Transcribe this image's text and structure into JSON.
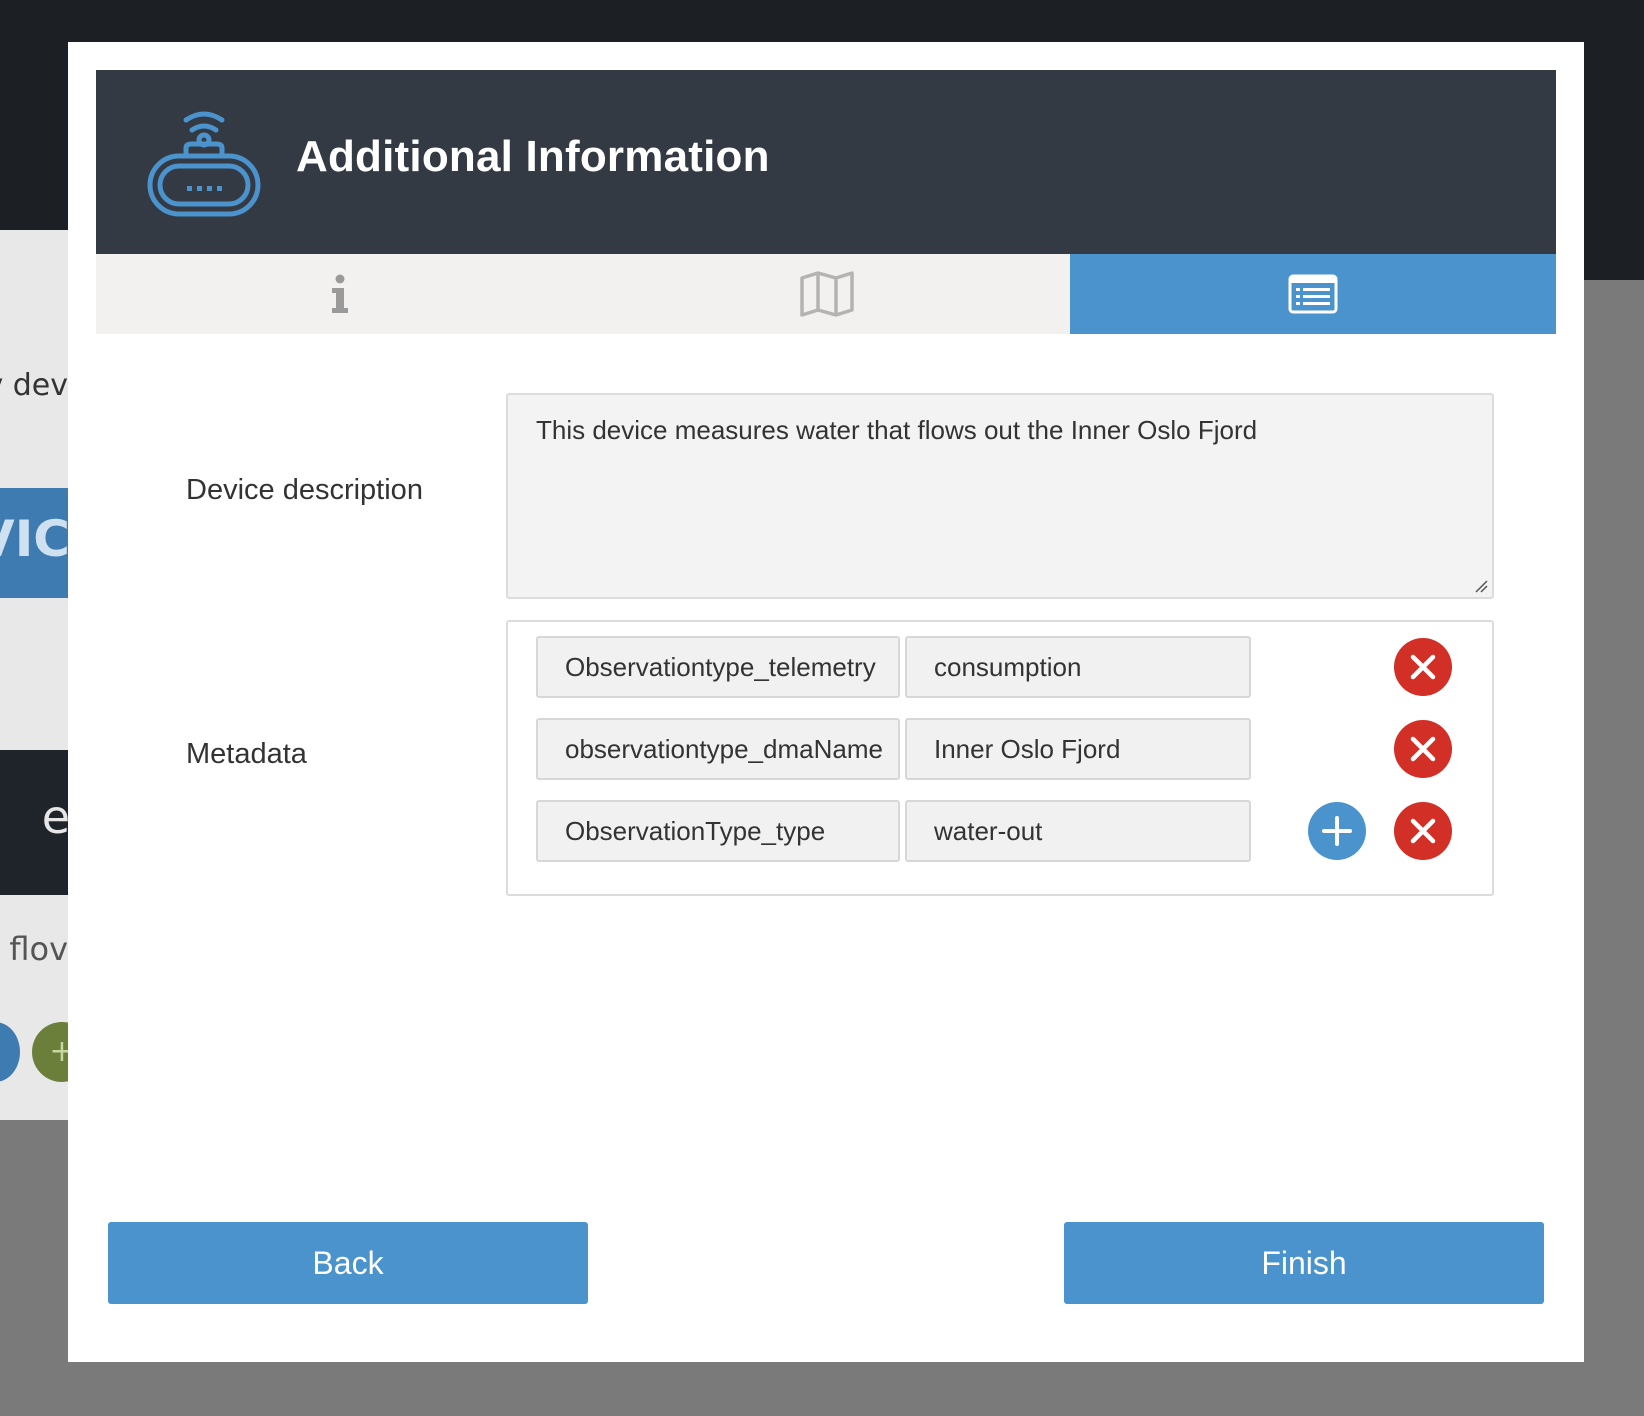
{
  "background": {
    "text_a": "v dev",
    "banner_text": "EVIC",
    "dark_text": "e",
    "text_b": "at flov"
  },
  "modal": {
    "title": "Additional Information",
    "header_icon": "router-icon",
    "tabs": [
      {
        "icon": "info-icon",
        "active": false
      },
      {
        "icon": "map-icon",
        "active": false
      },
      {
        "icon": "list-icon",
        "active": true
      }
    ],
    "description_label": "Device description",
    "description_value": "This device measures water that flows out the Inner Oslo Fjord",
    "metadata_label": "Metadata",
    "metadata": [
      {
        "key": "Observationtype_telemetry",
        "value": "consumption"
      },
      {
        "key": "observationtype_dmaName",
        "value": "Inner Oslo Fjord"
      },
      {
        "key": "ObservationType_type",
        "value": "water-out"
      }
    ],
    "back_label": "Back",
    "finish_label": "Finish"
  },
  "colors": {
    "accent": "#4b93cc",
    "header_bg": "#343a43",
    "danger": "#d22f27"
  }
}
